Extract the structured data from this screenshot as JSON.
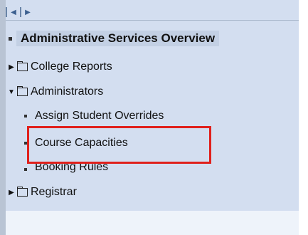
{
  "toolbar": {
    "prev_glyph": "◀",
    "next_glyph": "▶"
  },
  "tree": {
    "title": "Administrative Services Overview",
    "items": [
      {
        "label": "College Reports",
        "expanded": false,
        "icon": "folder-icon"
      },
      {
        "label": "Administrators",
        "expanded": true,
        "icon": "folder-icon",
        "children": [
          {
            "label": "Assign Student Overrides"
          },
          {
            "label": "Course Capacities",
            "highlighted": true
          },
          {
            "label": "Booking Rules"
          }
        ]
      },
      {
        "label": "Registrar",
        "expanded": false,
        "icon": "folder-icon"
      }
    ]
  },
  "colors": {
    "panel_bg": "#d3def0",
    "title_bg": "#c3d0e4",
    "highlight_border": "#e0201c"
  }
}
